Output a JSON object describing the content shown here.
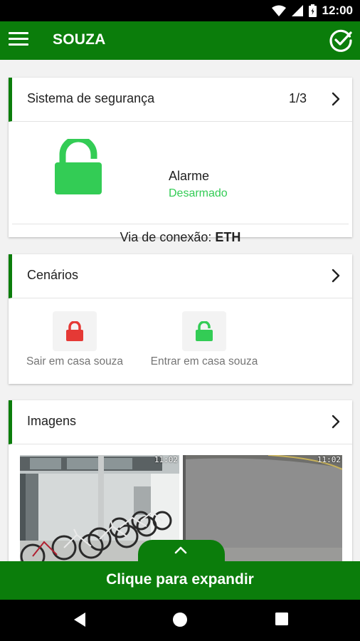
{
  "status_bar": {
    "time": "12:00"
  },
  "app_bar": {
    "title": "SOUZA"
  },
  "security": {
    "title": "Sistema de segurança",
    "count": "1/3",
    "alarm_label": "Alarme",
    "alarm_state": "Desarmado",
    "connection_prefix": "Via de conexão: ",
    "connection_value": "ETH"
  },
  "scenes": {
    "title": "Cenários",
    "items": [
      {
        "label": "Sair em casa souza",
        "icon": "lock-closed-icon",
        "color": "#e53935"
      },
      {
        "label": "Entrar em casa souza",
        "icon": "lock-open-icon",
        "color": "#33cc55"
      }
    ]
  },
  "images": {
    "title": "Imagens",
    "cameras": [
      {
        "time": "11:02"
      },
      {
        "time": "11:02"
      }
    ]
  },
  "expand": {
    "label": "Clique para expandir"
  },
  "colors": {
    "primary": "#0b7d0b",
    "armed": "#e53935",
    "disarmed": "#33cc55"
  }
}
